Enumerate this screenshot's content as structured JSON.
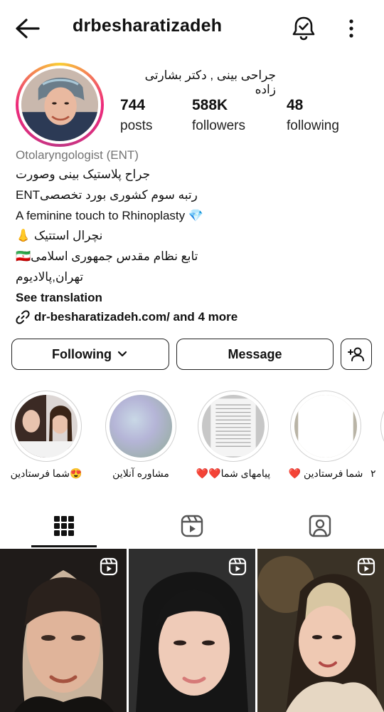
{
  "header": {
    "username": "drbesharatizadeh"
  },
  "profile": {
    "display_name": "جراحی بینی , دکتر بشارتی زاده",
    "stats": [
      {
        "value": "744",
        "label": "posts"
      },
      {
        "value": "588K",
        "label": "followers"
      },
      {
        "value": "48",
        "label": "following"
      }
    ]
  },
  "bio": {
    "category": "Otolaryngologist (ENT)",
    "lines": [
      "جراح پلاستیک بینی وصورت",
      "رتبه سوم کشوری بورد تخصصیENT",
      "A feminine touch to Rhinoplasty 💎",
      "نچرال استتیک 👃",
      "🇮🇷تابع نظام مقدس جمهوری اسلامی",
      "تهران,پالادیوم"
    ],
    "see_translation": "See translation",
    "link": "dr-besharatizadeh.com/ and 4 more"
  },
  "actions": {
    "following": "Following",
    "message": "Message"
  },
  "highlights": [
    {
      "label": "😍شما فرستادین"
    },
    {
      "label": "مشاوره آنلاین"
    },
    {
      "label": "پیامهای شما❤️❤️"
    },
    {
      "label": "شما فرستادین ❤️"
    },
    {
      "label": "۲"
    }
  ],
  "tabs": [
    {
      "icon": "grid-icon"
    },
    {
      "icon": "reels-icon"
    },
    {
      "icon": "tagged-icon"
    }
  ],
  "colors": {
    "ring_start": "#f9ce34",
    "ring_mid": "#ee2a7b",
    "ring_end": "#c13584",
    "verified_diamond": "#36b4f0"
  }
}
